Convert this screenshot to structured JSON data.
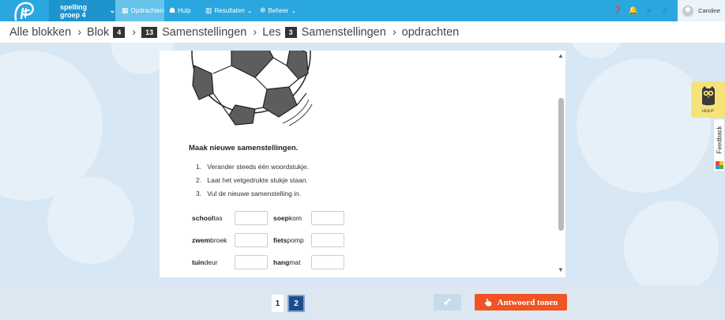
{
  "app": {
    "logo_text": "Pit",
    "course": "spelling groep 4"
  },
  "nav": {
    "items": [
      {
        "label": "Opdrachten",
        "icon": "assignment-icon"
      },
      {
        "label": "Hulp",
        "icon": "owl-icon"
      },
      {
        "label": "Resultaten",
        "icon": "chart-icon"
      },
      {
        "label": "Beheer",
        "icon": "gear-icon"
      }
    ],
    "user": "Caroline"
  },
  "breadcrumb": {
    "all": "Alle blokken",
    "blok_label": "Blok",
    "blok_num": "4",
    "les_num_prefix": "13",
    "lesson_name": "Samenstellingen",
    "les_label": "Les",
    "les_num": "3",
    "section": "Samenstellingen",
    "tail": "opdrachten",
    "separator": "›"
  },
  "task": {
    "title": "Maak nieuwe samenstellingen.",
    "steps": [
      {
        "n": "1.",
        "text": "Verander steeds één woordstukje."
      },
      {
        "n": "2.",
        "text": "Laat het vetgedrukte stukje staan."
      },
      {
        "n": "3.",
        "text": "Vul de nieuwe samenstelling in."
      }
    ],
    "words": [
      {
        "bold": "school",
        "rest": "tas",
        "value": ""
      },
      {
        "bold": "soep",
        "rest": "kom",
        "value": ""
      },
      {
        "bold": "zwem",
        "rest": "broek",
        "value": ""
      },
      {
        "bold": "fiets",
        "rest": "pomp",
        "value": ""
      },
      {
        "bold": "tuin",
        "rest": "deur",
        "value": ""
      },
      {
        "bold": "hang",
        "rest": "mat",
        "value": ""
      }
    ]
  },
  "side": {
    "help_label": "HULP",
    "feedback_label": "Feedback"
  },
  "footer": {
    "pages": [
      "1",
      "2"
    ],
    "current_page": "2",
    "check_symbol": "✔",
    "answer_label": "Antwoord tonen"
  },
  "colors": {
    "topbar": "#2aa7df",
    "answer": "#f05423",
    "active_page": "#1c4e8a",
    "help_tab": "#f7e27a"
  }
}
